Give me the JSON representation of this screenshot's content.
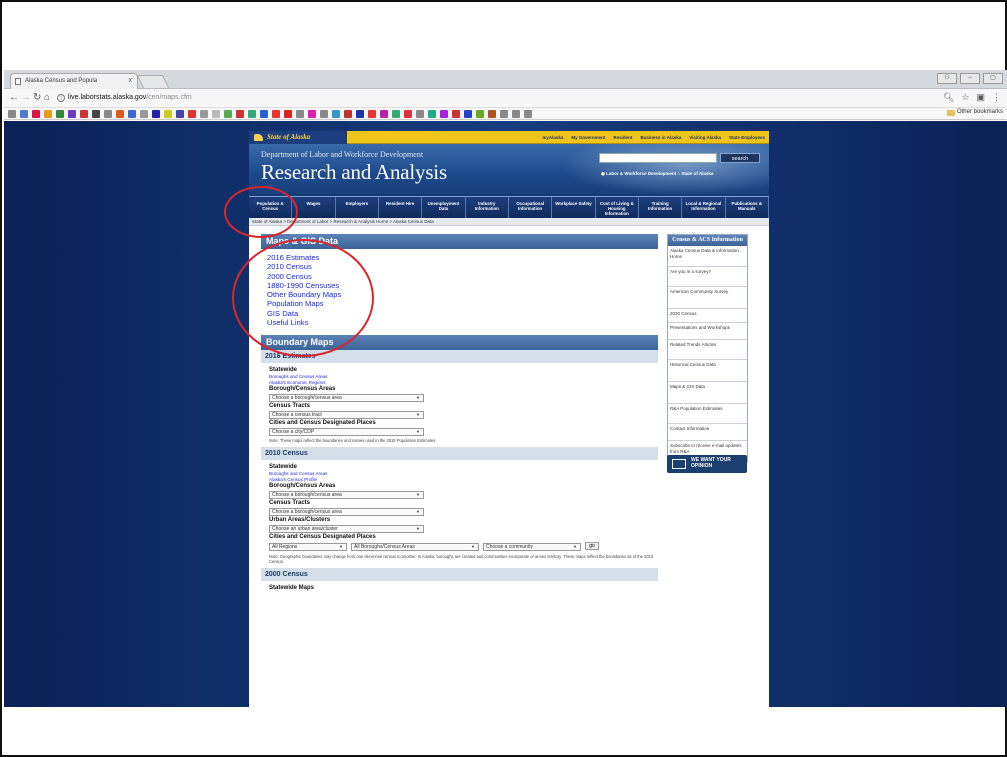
{
  "browser": {
    "tab_title": "Alaska Census and Popula",
    "tab_close": "x",
    "url_host": "live.laborstats.alaska.gov",
    "url_path": "/cen/maps.cfm",
    "other_bookmarks": "Other bookmarks",
    "bookmark_colors": [
      "#888",
      "#4a7bd0",
      "#d14",
      "#e89c1e",
      "#2d8a3e",
      "#6a3cc0",
      "#c33",
      "#444",
      "#888",
      "#e05a1f",
      "#3d6ad1",
      "#999",
      "#22a",
      "#cc2",
      "#44a",
      "#d33",
      "#999",
      "#bbb",
      "#5a5",
      "#c33",
      "#3a7",
      "#2a5fd3",
      "#e33",
      "#d22",
      "#888",
      "#d2a",
      "#888",
      "#39c",
      "#b33",
      "#23a",
      "#e33",
      "#b2a",
      "#3a7",
      "#d33",
      "#888",
      "#2a8",
      "#a2d",
      "#c33",
      "#24c",
      "#6a2",
      "#a52",
      "#888",
      "#888",
      "#888"
    ]
  },
  "site": {
    "state_brand": "State of Alaska",
    "top_links": [
      "myAlaska",
      "My Government",
      "Resident",
      "Business in Alaska",
      "Visiting Alaska",
      "State Employees"
    ],
    "department": "Department of Labor and Workforce Development",
    "title": "Research and Analysis",
    "search_label": "search",
    "radio_text": "◉ Labor & Workforce Development  ○ State of Alaska",
    "nav": [
      "Population & Census",
      "Wages",
      "Employers",
      "Resident Hire",
      "Unemployment Data",
      "Industry Information",
      "Occupational Information",
      "Workplace Safety",
      "Cost of Living & Housing Information",
      "Training Information",
      "Local & Regional Information",
      "Publications & Manuals"
    ],
    "breadcrumb": "State of Alaska > Department of Labor > Research & Analysis Home > Alaska Census Data"
  },
  "content": {
    "maps_heading": "Maps & GIS Data",
    "maps_links": [
      "2016 Estimates",
      "2010 Census",
      "2000 Census",
      "1880-1990 Censuses",
      "Other Boundary Maps",
      "Population Maps",
      "GIS Data",
      "Useful Links"
    ],
    "boundary_heading": "Boundary Maps",
    "est2016": {
      "heading": "2016 Estimates",
      "statewide": "Statewide",
      "links": [
        "Boroughs and Census Areas",
        "Alaska's Economic Regions"
      ],
      "borough_title": "Borough/Census Areas",
      "borough_select": "Choose a borough/census area",
      "tracts_title": "Census Tracts",
      "tracts_select": "Choose a census tract",
      "cities_title": "Cities and Census Designated Places",
      "cities_select": "Choose a city/CDP",
      "note": "Note: These maps reflect the boundaries and names used in the 2016 Population Estimates."
    },
    "census2010": {
      "heading": "2010 Census",
      "statewide": "Statewide",
      "links": [
        "Boroughs and Census Areas",
        "Alaska's Census Profile"
      ],
      "borough_title": "Borough/Census Areas",
      "borough_select": "Choose a borough/census area",
      "tracts_title": "Census Tracts",
      "tracts_select": "Choose a borough/census area",
      "urban_title": "Urban Areas/Clusters",
      "urban_select": "Choose an urban area/cluster",
      "cities_title": "Cities and Census Designated Places",
      "region_select": "All Regions",
      "borough_all": "All Boroughs/Census Areas",
      "community_select": "Choose a community",
      "go": "go",
      "note": "Note: Geographic boundaries may change from one decennial census to another. In Alaska, boroughs are created and communities incorporate or annex territory. These maps reflect the boundaries as of the 2010 Census."
    },
    "census2000": {
      "heading": "2000 Census",
      "statewide": "Statewide Maps"
    }
  },
  "sidebar": {
    "heading": "Census & ACS Information",
    "items": [
      "Alaska Census Data & Information Home",
      "Are you in a survey?",
      "American Community Survey",
      "2020 Census",
      "Presentations and Workshops",
      "Related Trends Articles",
      "Historical Census Data",
      "Maps & GIS Data",
      "R&A Population Estimates",
      "Contact Information",
      "Subscribe to receive e-mail updates from R&A"
    ],
    "opinion": "WE WANT YOUR OPINION"
  }
}
